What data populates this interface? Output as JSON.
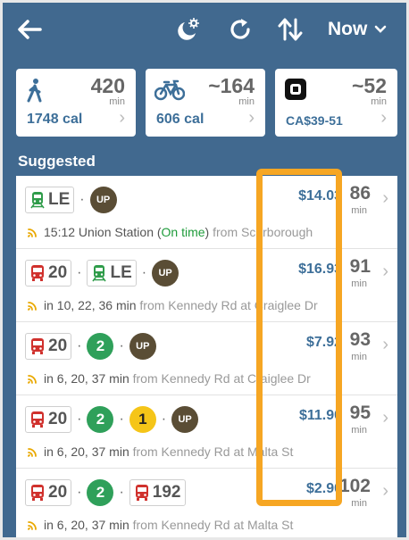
{
  "topbar": {
    "back_icon": "arrow-left-icon",
    "time_picker_label": "Now"
  },
  "modes": [
    {
      "icon": "walk-icon",
      "time": "420",
      "unit": "min",
      "sub": "1748 cal"
    },
    {
      "icon": "bike-icon",
      "time": "~164",
      "unit": "min",
      "sub": "606 cal"
    },
    {
      "icon": "ride-hail-icon",
      "time": "~52",
      "unit": "min",
      "sub": "CA$39-51"
    }
  ],
  "section_title": "Suggested",
  "routes": [
    {
      "chips": [
        {
          "type": "box",
          "icon": "train-icon",
          "text": "LE"
        },
        {
          "type": "circle",
          "style": "up",
          "text": "UP"
        }
      ],
      "price": "$14.03",
      "duration": "86",
      "unit": "min",
      "detail_main": "15:12 Union Station (",
      "detail_status": "On time",
      "detail_close": ")",
      "detail_from": " from Scarborough"
    },
    {
      "chips": [
        {
          "type": "box",
          "icon": "bus-icon",
          "text": "20"
        },
        {
          "type": "box",
          "icon": "train-icon",
          "text": "LE"
        },
        {
          "type": "circle",
          "style": "up",
          "text": "UP"
        }
      ],
      "price": "$16.93",
      "duration": "91",
      "unit": "min",
      "detail_main": "in 10, 22, 36 min",
      "detail_from": " from Kennedy Rd at Craiglee Dr"
    },
    {
      "chips": [
        {
          "type": "box",
          "icon": "bus-icon",
          "text": "20"
        },
        {
          "type": "circle",
          "style": "green",
          "text": "2"
        },
        {
          "type": "circle",
          "style": "up",
          "text": "UP"
        }
      ],
      "price": "$7.92",
      "duration": "93",
      "unit": "min",
      "detail_main": "in 6, 20, 37 min",
      "detail_from": " from Kennedy Rd at Craiglee Dr"
    },
    {
      "chips": [
        {
          "type": "box",
          "icon": "bus-icon",
          "text": "20"
        },
        {
          "type": "circle",
          "style": "green",
          "text": "2"
        },
        {
          "type": "circle",
          "style": "yellow",
          "text": "1"
        },
        {
          "type": "circle",
          "style": "up",
          "text": "UP"
        }
      ],
      "price": "$11.90",
      "duration": "95",
      "unit": "min",
      "detail_main": "in 6, 20, 37 min",
      "detail_from": " from Kennedy Rd at Malta St"
    },
    {
      "chips": [
        {
          "type": "box",
          "icon": "bus-icon",
          "text": "20"
        },
        {
          "type": "circle",
          "style": "green",
          "text": "2"
        },
        {
          "type": "box",
          "icon": "bus-icon",
          "text": "192"
        }
      ],
      "price": "$2.90",
      "duration": "102",
      "unit": "min",
      "detail_main": "in 6, 20, 37 min",
      "detail_from": " from Kennedy Rd at Malta St"
    }
  ],
  "colors": {
    "header": "#41698f",
    "price": "#3d6f99",
    "highlight": "#f6a623",
    "ontime": "#1e9b3a"
  }
}
